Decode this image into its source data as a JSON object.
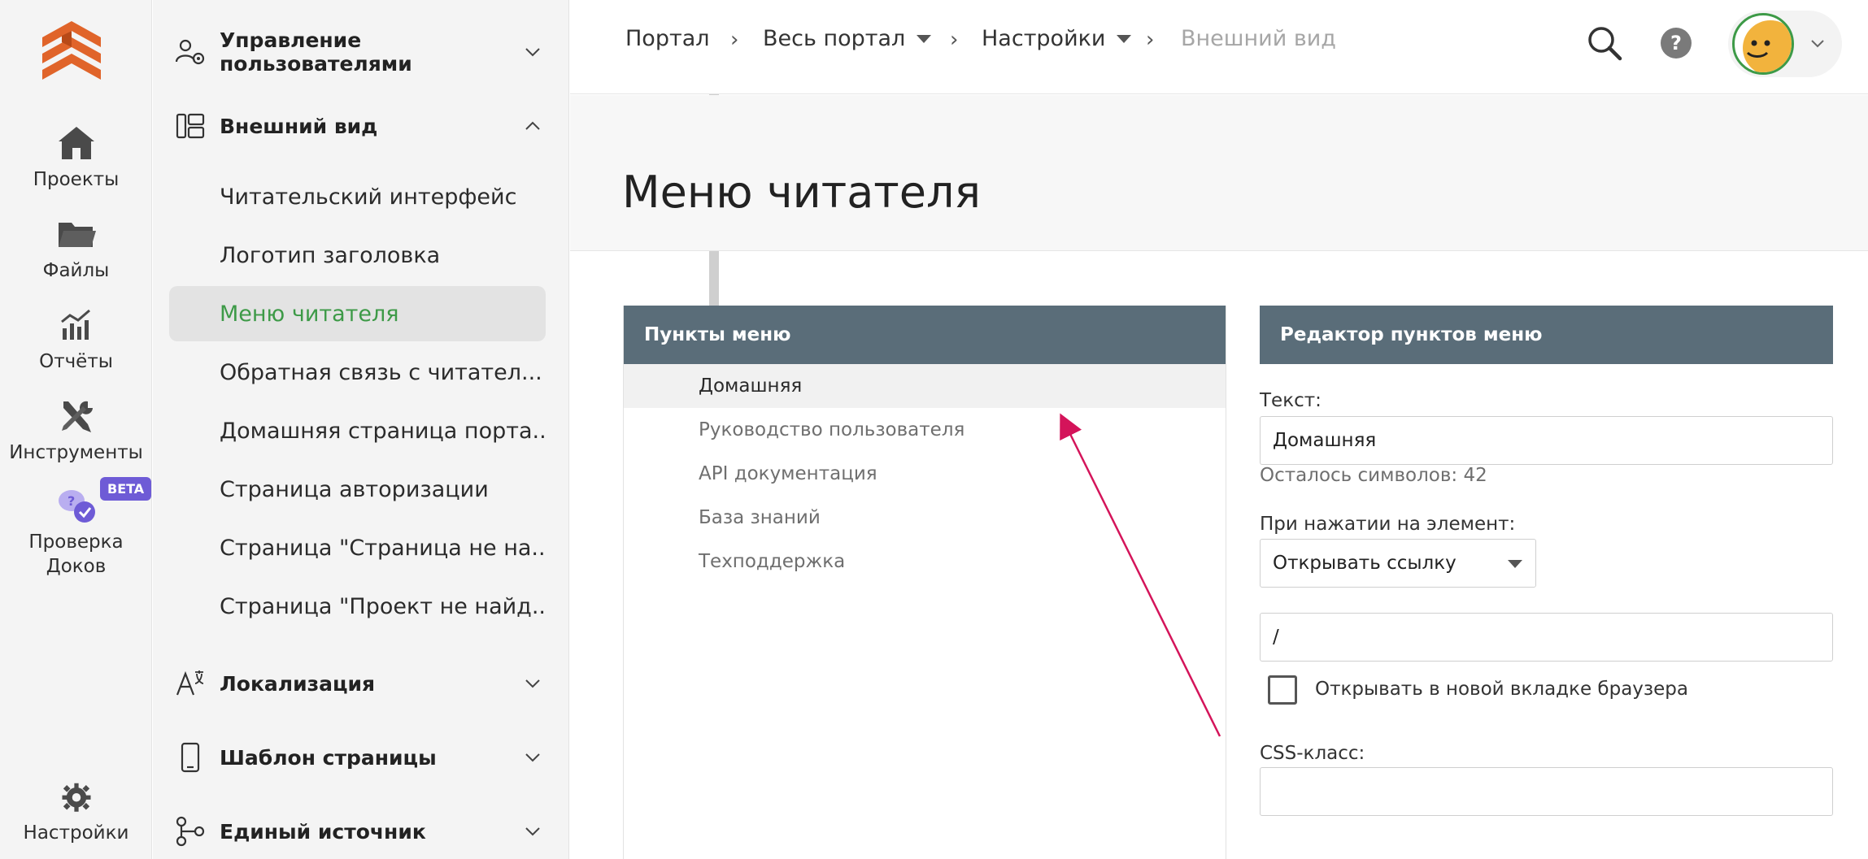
{
  "rail": {
    "items": [
      {
        "label": "Проекты",
        "icon": "home-icon"
      },
      {
        "label": "Файлы",
        "icon": "folder-icon"
      },
      {
        "label": "Отчёты",
        "icon": "reports-chart-icon"
      },
      {
        "label": "Инструменты",
        "icon": "tools-icon"
      },
      {
        "label": "Проверка Доков",
        "icon": "doc-check-chat-icon"
      }
    ],
    "beta_badge": "BETA",
    "settings_label": "Настройки"
  },
  "nav": {
    "groups": [
      {
        "label": "Управление пользователями",
        "icon": "users-settings-icon",
        "expanded": false
      },
      {
        "label": "Внешний вид",
        "icon": "appearance-icon",
        "expanded": true
      },
      {
        "label": "Локализация",
        "icon": "localization-icon",
        "expanded": false
      },
      {
        "label": "Шаблон страницы",
        "icon": "phone-template-icon",
        "expanded": false
      },
      {
        "label": "Единый источник",
        "icon": "single-source-icon",
        "expanded": false
      }
    ],
    "appearance_items": [
      "Читательский интерфейс",
      "Логотип заголовка",
      "Меню читателя",
      "Обратная связь с читател...",
      "Домашняя страница порта...",
      "Страница авторизации",
      "Страница \"Страница не на...",
      "Страница \"Проект не найд..."
    ],
    "active_item": "Меню читателя"
  },
  "breadcrumb": {
    "items": [
      "Портал",
      "Весь портал",
      "Настройки",
      "Внешний вид"
    ],
    "separator": "›"
  },
  "header": {
    "help_label": "?"
  },
  "page": {
    "title": "Меню читателя"
  },
  "menu_items_panel": {
    "title": "Пункты меню",
    "items": [
      "Домашняя",
      "Руководство пользователя",
      "API документация",
      "База знаний",
      "Техподдержка"
    ],
    "selected": "Домашняя"
  },
  "editor": {
    "title": "Редактор пунктов меню",
    "text_label": "Текст:",
    "text_value": "Домашняя",
    "chars_left": "Осталось символов: 42",
    "on_click_label": "При нажатии на элемент:",
    "on_click_value": "Открывать ссылку",
    "link_value": "/",
    "new_tab_label": "Открывать в новой вкладке браузера",
    "new_tab_checked": false,
    "css_label": "CSS-класс:",
    "css_value": ""
  },
  "colors": {
    "accent_green": "#3d9a47",
    "panel_header": "#5a6d79",
    "beta": "#6e5bd6",
    "logo_orange": "#e0642a",
    "annotation_arrow": "#d4145a"
  }
}
